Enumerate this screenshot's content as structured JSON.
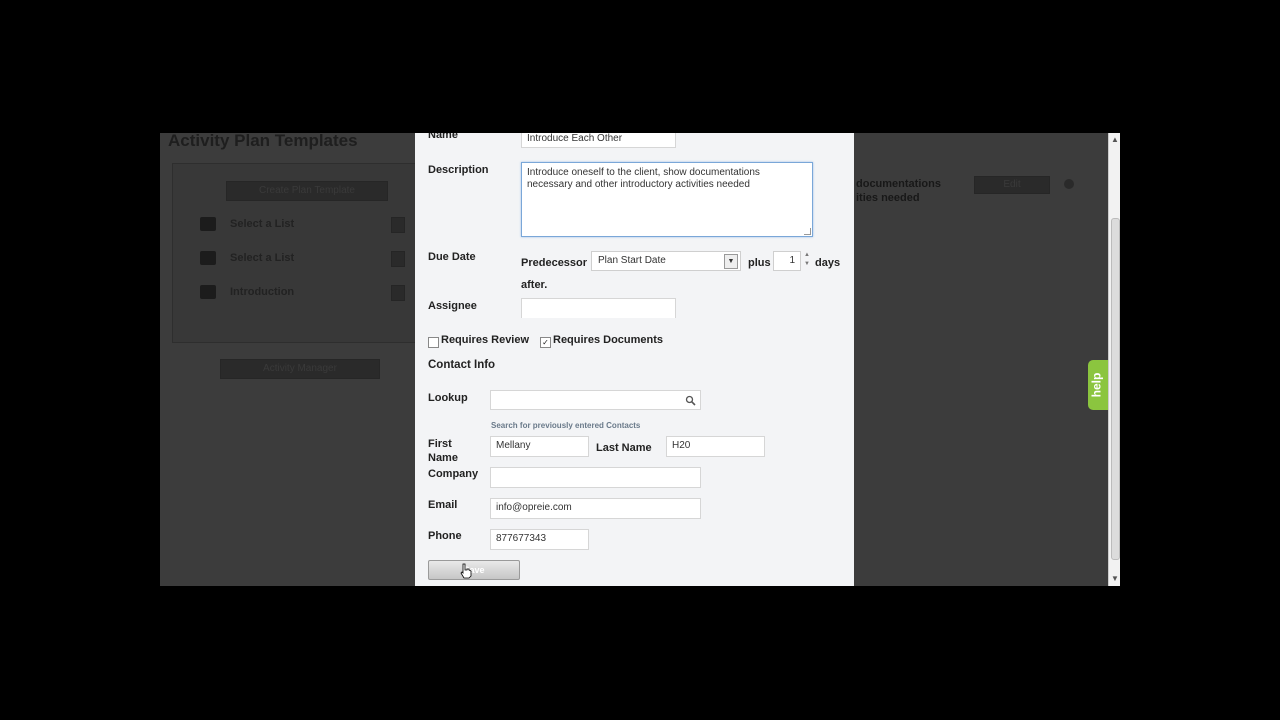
{
  "background": {
    "page_title": "Activity Plan Templates",
    "create_button": "Create Plan Template",
    "list_rows": [
      {
        "icon": "signpost-icon",
        "label": "Select a List"
      },
      {
        "icon": "home-icon",
        "label": "Select a List"
      },
      {
        "icon": "briefcase-icon",
        "label": "Introduction"
      }
    ],
    "activity_manager_button": "Activity Manager",
    "right_description": [
      "documentations",
      "ities needed"
    ],
    "right_button": "Edit"
  },
  "help": {
    "label": "help"
  },
  "form": {
    "name_label": "Name",
    "name_value": "Introduce Each Other",
    "description_label": "Description",
    "description_lines": [
      "Introduce oneself to the client, show documentations",
      "necessary and other introductory activities needed"
    ],
    "due_date_label": "Due Date",
    "predecessor_label": "Predecessor",
    "predecessor_value": "Plan Start Date",
    "plus_label": "plus",
    "days_value": "1",
    "days_label": "days",
    "after_label": "after.",
    "assignee_label": "Assignee",
    "assignee_value": "",
    "requires_review_label": "Requires Review",
    "requires_review_checked": false,
    "requires_documents_label": "Requires Documents",
    "requires_documents_checked": true,
    "contact_info_label": "Contact Info",
    "lookup_label": "Lookup",
    "lookup_value": "",
    "lookup_hint": "Search for previously entered Contacts",
    "first_name_label": [
      "First",
      "Name"
    ],
    "first_name_value": "Mellany",
    "last_name_label": "Last Name",
    "last_name_value": "H20",
    "company_label": "Company",
    "company_value": "",
    "email_label": "Email",
    "email_value": "info@opreie.com",
    "phone_label": "Phone",
    "phone_value": "877677343",
    "save_button": "Save"
  },
  "colors": {
    "modal_bg": "#f3f4f6",
    "focus_border": "#7aa7d8",
    "help_tab": "#8bc53f",
    "hint_text": "#6a7a8a"
  }
}
